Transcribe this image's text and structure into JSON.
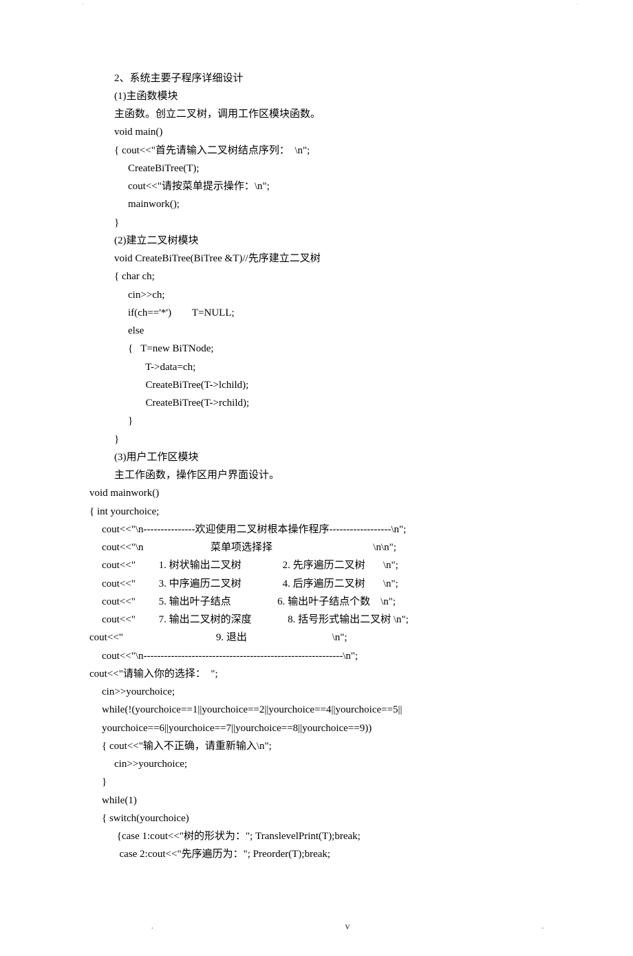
{
  "lines": [
    {
      "cls": "i1",
      "text": "2、系统主要子程序详细设计"
    },
    {
      "cls": "i1",
      "text": "(1)主函数模块"
    },
    {
      "cls": "i1",
      "text": "主函数。创立二叉树，调用工作区模块函数。"
    },
    {
      "cls": "i1",
      "text": "void main()"
    },
    {
      "cls": "i1",
      "text": "{ cout<<\"首先请输入二叉树结点序列：  \\n\";"
    },
    {
      "cls": "i2",
      "text": "CreateBiTree(T);"
    },
    {
      "cls": "i2",
      "text": "cout<<\"请按菜单提示操作：\\n\";"
    },
    {
      "cls": "i2",
      "text": "mainwork();"
    },
    {
      "cls": "i1",
      "text": "}"
    },
    {
      "cls": "i1",
      "text": "(2)建立二叉树模块"
    },
    {
      "cls": "i1",
      "text": "void CreateBiTree(BiTree &T)//先序建立二叉树"
    },
    {
      "cls": "i1",
      "text": "{ char ch;"
    },
    {
      "cls": "i2",
      "text": "cin>>ch;"
    },
    {
      "cls": "i2",
      "text": "if(ch=='*')        T=NULL;"
    },
    {
      "cls": "i2",
      "text": "else"
    },
    {
      "cls": "i2",
      "text": "{   T=new BiTNode;"
    },
    {
      "cls": "i3",
      "text": "  T->data=ch;"
    },
    {
      "cls": "i3",
      "text": "  CreateBiTree(T->lchild);"
    },
    {
      "cls": "i3",
      "text": "  CreateBiTree(T->rchild);"
    },
    {
      "cls": "i2",
      "text": "}"
    },
    {
      "cls": "i1",
      "text": "}"
    },
    {
      "cls": "i1",
      "text": "(3)用户工作区模块"
    },
    {
      "cls": "i1",
      "text": "主工作函数，操作区用户界面设计。"
    },
    {
      "cls": "i0",
      "text": "void mainwork()"
    },
    {
      "cls": "i0",
      "text": "{ int yourchoice;"
    },
    {
      "cls": "ic",
      "text": "cout<<\"\\n---------------欢迎使用二叉树根本操作程序------------------\\n\";"
    },
    {
      "cls": "ic",
      "text": "cout<<\"\\n                          菜单项选择择                                       \\n\\n\";"
    },
    {
      "cls": "ic",
      "text": "cout<<\"         1. 树状输出二叉树                2. 先序遍历二叉树       \\n\";"
    },
    {
      "cls": "ic",
      "text": "cout<<\"         3. 中序遍历二叉树                4. 后序遍历二叉树       \\n\";"
    },
    {
      "cls": "ic",
      "text": "cout<<\"         5. 输出叶子结点                  6. 输出叶子结点个数    \\n\";"
    },
    {
      "cls": "ic",
      "text": "cout<<\"         7. 输出二叉树的深度              8. 括号形式输出二叉树 \\n\";"
    },
    {
      "cls": "i0",
      "text": "cout<<\"                                    9. 退出                                 \\n\";"
    },
    {
      "cls": "ic",
      "text": "cout<<\"\\n----------------------------------------------------------\\n\";"
    },
    {
      "cls": "i0",
      "text": "cout<<\"请输入你的选择：  \";"
    },
    {
      "cls": "ic",
      "text": "cin>>yourchoice;"
    },
    {
      "cls": "ic",
      "text": "while(!(yourchoice==1||yourchoice==2||yourchoice==4||yourchoice==5||"
    },
    {
      "cls": "ic",
      "text": "yourchoice==6||yourchoice==7||yourchoice==8||yourchoice==9))"
    },
    {
      "cls": "ic",
      "text": "{ cout<<\"输入不正确，请重新输入\\n\";"
    },
    {
      "cls": "i1",
      "text": "cin>>yourchoice;"
    },
    {
      "cls": "ic",
      "text": "}"
    },
    {
      "cls": "ic",
      "text": "while(1)"
    },
    {
      "cls": "ic",
      "text": "{ switch(yourchoice)"
    },
    {
      "cls": "i1",
      "text": " {case 1:cout<<\"树的形状为：\"; TranslevelPrint(T);break;"
    },
    {
      "cls": "i1",
      "text": "  case 2:cout<<\"先序遍历为：\"; Preorder(T);break;"
    }
  ],
  "footer": {
    "left": ".",
    "center": "v",
    "right": "."
  }
}
